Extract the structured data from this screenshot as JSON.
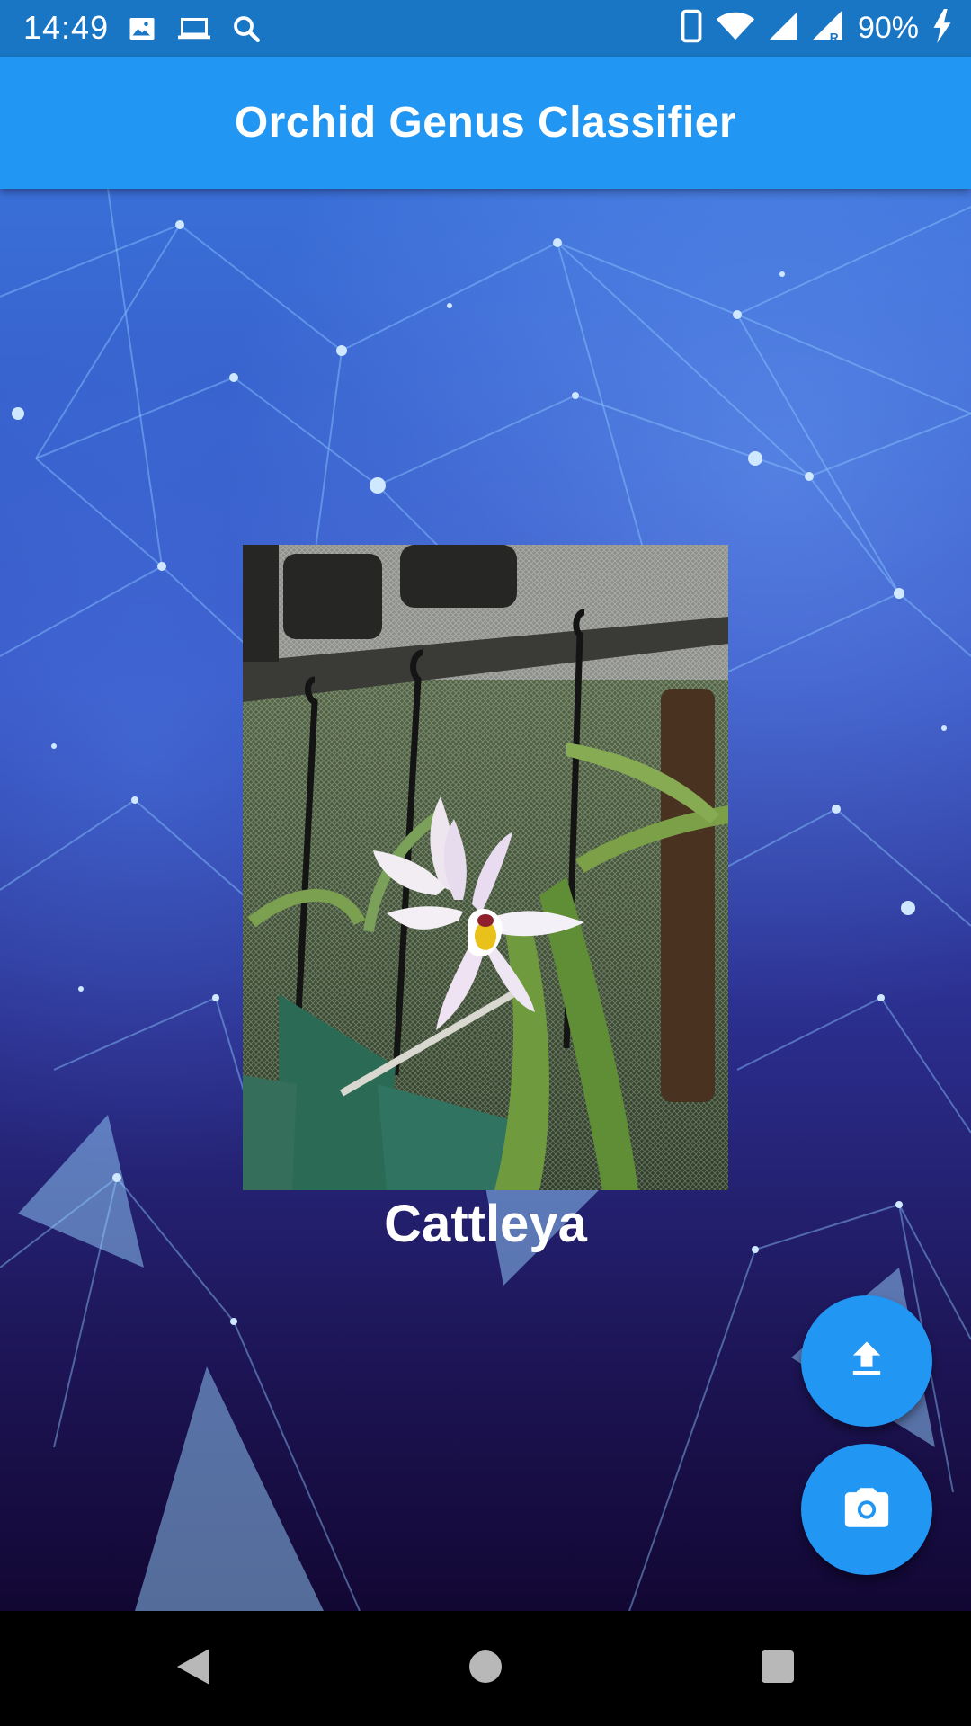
{
  "status_bar": {
    "time": "14:49",
    "battery": "90%",
    "left_icons": [
      "image-icon",
      "laptop-icon",
      "search-icon"
    ],
    "right_icons": [
      "phone-icon",
      "wifi-icon",
      "signal-icon",
      "signal-roaming-icon",
      "charging-icon"
    ]
  },
  "app_bar": {
    "title": "Orchid Genus Classifier"
  },
  "main": {
    "photo": {
      "subject": "orchid-photo"
    },
    "result_label": "Cattleya"
  },
  "actions": [
    {
      "name": "upload",
      "icon": "upload-icon"
    },
    {
      "name": "camera",
      "icon": "camera-icon"
    }
  ],
  "navigation": [
    "back-icon",
    "home-icon",
    "recents-icon"
  ],
  "colors": {
    "status_bar": "#1976c4",
    "app_bar": "#2196f3",
    "fab": "#2196f3",
    "nav_bar": "#000000"
  }
}
